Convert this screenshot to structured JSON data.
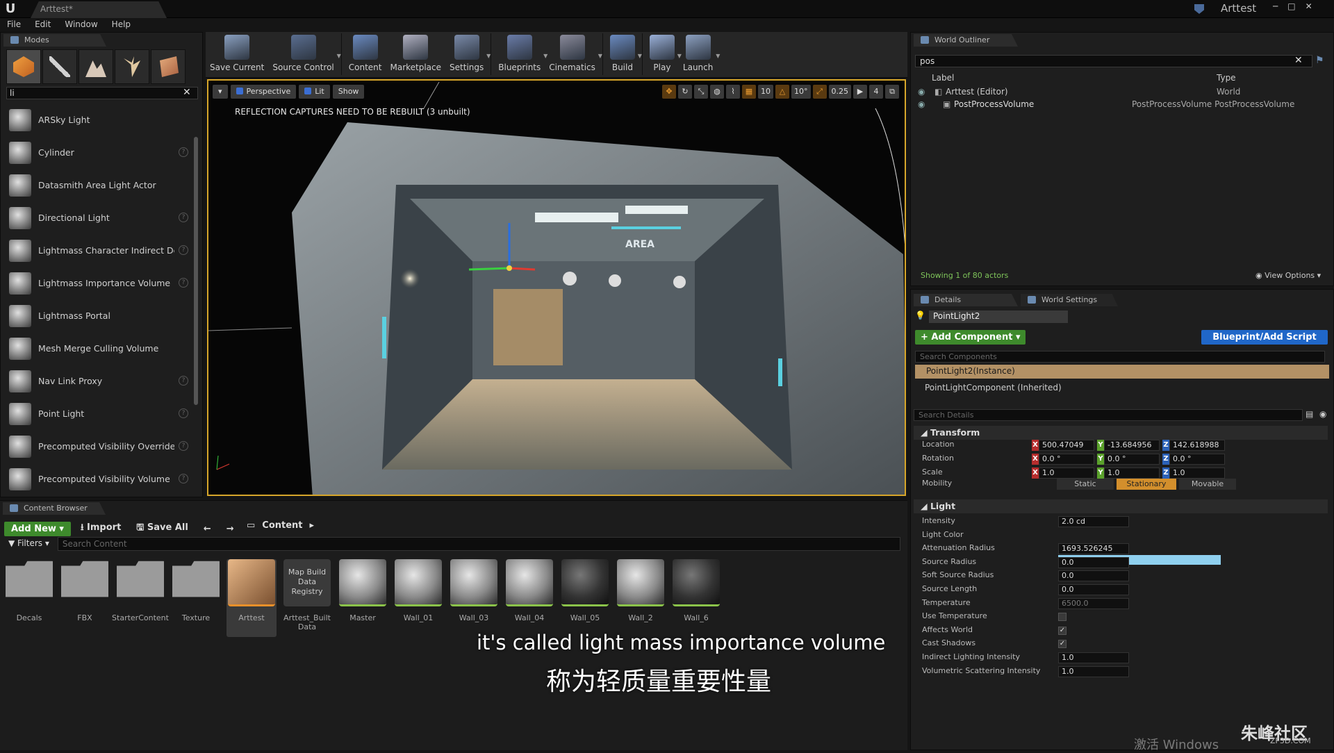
{
  "titlebar": {
    "tab": "Arttest*",
    "project": "Arttest"
  },
  "menu": [
    "File",
    "Edit",
    "Window",
    "Help"
  ],
  "modes": {
    "tab": "Modes",
    "search_value": "li",
    "items": [
      {
        "label": "ARSky Light",
        "help": false
      },
      {
        "label": "Cylinder",
        "help": true
      },
      {
        "label": "Datasmith Area Light Actor",
        "help": false
      },
      {
        "label": "Directional Light",
        "help": true
      },
      {
        "label": "Lightmass Character Indirect Detail Volume",
        "help": true
      },
      {
        "label": "Lightmass Importance Volume",
        "help": true
      },
      {
        "label": "Lightmass Portal",
        "help": false
      },
      {
        "label": "Mesh Merge Culling Volume",
        "help": false
      },
      {
        "label": "Nav Link Proxy",
        "help": true
      },
      {
        "label": "Point Light",
        "help": true
      },
      {
        "label": "Precomputed Visibility Override Volume",
        "help": true
      },
      {
        "label": "Precomputed Visibility Volume",
        "help": true
      }
    ]
  },
  "toolbar": [
    {
      "label": "Save Current",
      "color": "#8aa0c0",
      "caret": false
    },
    {
      "label": "Source Control",
      "color": "#5a6e90",
      "caret": true
    },
    {
      "label": "Content",
      "color": "#6a8ac0",
      "caret": false
    },
    {
      "label": "Marketplace",
      "color": "#b0b0c0",
      "caret": false
    },
    {
      "label": "Settings",
      "color": "#7a8aa8",
      "caret": true
    },
    {
      "label": "Blueprints",
      "color": "#6a7ca8",
      "caret": true
    },
    {
      "label": "Cinematics",
      "color": "#8a8a9a",
      "caret": true
    },
    {
      "label": "Build",
      "color": "#6a8ac0",
      "caret": true
    },
    {
      "label": "Play",
      "color": "#9ab0d8",
      "caret": true
    },
    {
      "label": "Launch",
      "color": "#8ca0c0",
      "caret": true
    }
  ],
  "viewport": {
    "perspective": "Perspective",
    "lit": "Lit",
    "show": "Show",
    "grid_snap": "10",
    "rot_snap": "10°",
    "scale_snap": "0.25",
    "cam_speed": "4",
    "message": "REFLECTION CAPTURES NEED TO BE REBUILT (3 unbuilt)"
  },
  "content_browser": {
    "tab": "Content Browser",
    "add_new": "Add New",
    "import": "Import",
    "save_all": "Save All",
    "path": "Content",
    "filters": "Filters",
    "search_placeholder": "Search Content",
    "items": [
      {
        "label": "Decals",
        "kind": "folder"
      },
      {
        "label": "FBX",
        "kind": "folder"
      },
      {
        "label": "StarterContent",
        "kind": "folder"
      },
      {
        "label": "Texture",
        "kind": "folder"
      },
      {
        "label": "Arttest",
        "kind": "level"
      },
      {
        "label": "Arttest_Built Data",
        "kind": "registry",
        "thumb_text": "Map Build Data Registry"
      },
      {
        "label": "Master",
        "kind": "sphere"
      },
      {
        "label": "Wall_01",
        "kind": "sphere"
      },
      {
        "label": "Wall_03",
        "kind": "sphere"
      },
      {
        "label": "Wall_04",
        "kind": "sphere"
      },
      {
        "label": "Wall_05",
        "kind": "sphere-dark"
      },
      {
        "label": "Wall_2",
        "kind": "sphere"
      },
      {
        "label": "Wall_6",
        "kind": "sphere-dark"
      }
    ]
  },
  "subtitle": {
    "en": "it's called light mass importance volume",
    "zh": "称为轻质量重要性量"
  },
  "outliner": {
    "tab": "World Outliner",
    "search_value": "pos",
    "col_label": "Label",
    "col_type": "Type",
    "rows": [
      {
        "label": "Arttest (Editor)",
        "type": "World"
      },
      {
        "label": "PostProcessVolume",
        "type": "PostProcessVolume PostProcessVolume"
      }
    ],
    "showing": "Showing 1 of 80 actors",
    "view_options": "View Options"
  },
  "details": {
    "tab": "Details",
    "ws_tab": "World Settings",
    "actor": "PointLight2",
    "add_component": "+ Add Component",
    "blueprint": "Blueprint/Add Script",
    "search_components": "Search Components",
    "comp_instance": "PointLight2(Instance)",
    "comp_light": "PointLightComponent (Inherited)",
    "search_details": "Search Details",
    "transform": "Transform",
    "location_label": "Location",
    "location": [
      "500.47049",
      "-13.684956",
      "142.618988"
    ],
    "rotation_label": "Rotation",
    "rotation": [
      "0.0 °",
      "0.0 °",
      "0.0 °"
    ],
    "scale_label": "Scale",
    "scale": [
      "1.0",
      "1.0",
      "1.0"
    ],
    "mobility_label": "Mobility",
    "mobility": [
      "Static",
      "Stationary",
      "Movable"
    ],
    "light": "Light",
    "props": [
      {
        "label": "Intensity",
        "value": "2.0 cd"
      },
      {
        "label": "Light Color",
        "value": null
      },
      {
        "label": "Attenuation Radius",
        "value": "1693.526245"
      },
      {
        "label": "Source Radius",
        "value": "0.0"
      },
      {
        "label": "Soft Source Radius",
        "value": "0.0"
      },
      {
        "label": "Source Length",
        "value": "0.0"
      },
      {
        "label": "Temperature",
        "value": "6500.0"
      },
      {
        "label": "Use Temperature",
        "value": null
      },
      {
        "label": "Affects World",
        "value": null
      },
      {
        "label": "Cast Shadows",
        "value": null
      },
      {
        "label": "Indirect Lighting Intensity",
        "value": "1.0"
      },
      {
        "label": "Volumetric Scattering Intensity",
        "value": "1.0"
      }
    ],
    "light_color_hex": "#8fd0ef"
  },
  "watermark": {
    "windows": "激活 Windows",
    "logo": "朱峰社区",
    "url": "ZF3D.COM"
  }
}
